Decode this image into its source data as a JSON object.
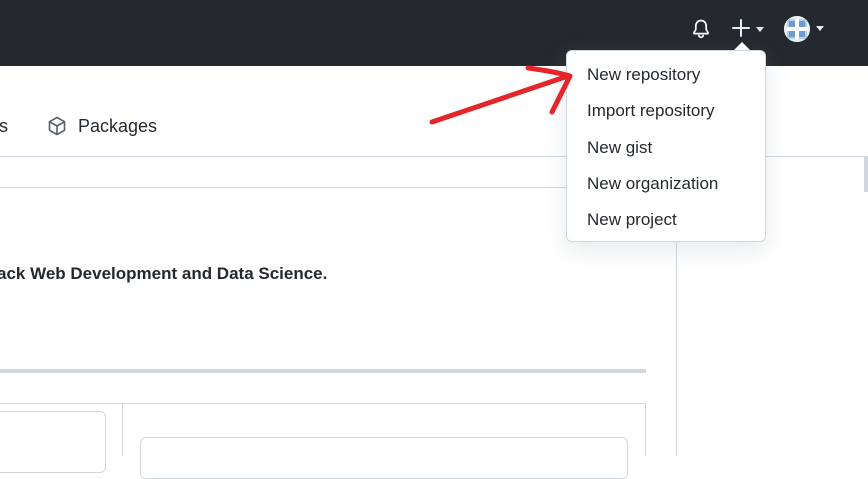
{
  "header": {
    "icons": {
      "bell": "bell-icon",
      "plus": "plus-icon",
      "caret": "triangle-down-icon",
      "avatar": "avatar"
    }
  },
  "tabs": {
    "partial_label": "ts",
    "packages_label": "Packages",
    "packages_icon": "package-icon"
  },
  "repo": {
    "description_fragment": "ack Web Development and Data Science."
  },
  "new_menu": {
    "items": [
      {
        "label": "New repository"
      },
      {
        "label": "Import repository"
      },
      {
        "label": "New gist"
      },
      {
        "label": "New organization"
      },
      {
        "label": "New project"
      }
    ]
  },
  "annotation": {
    "arrow_color": "#e5252a"
  },
  "colors": {
    "header_bg": "#24292f",
    "border": "#d0d7de",
    "text": "#24292f"
  }
}
